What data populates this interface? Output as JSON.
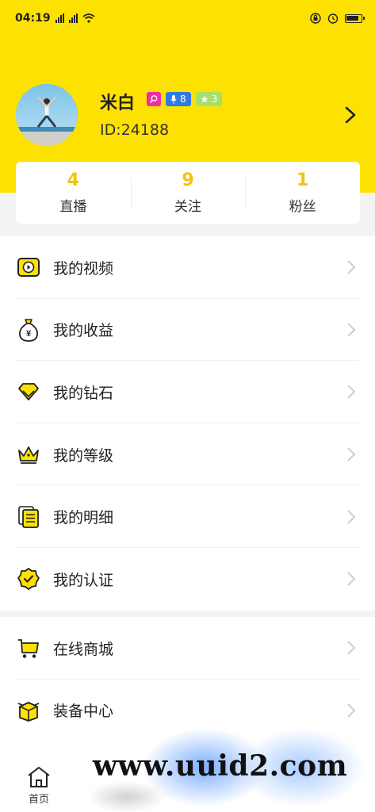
{
  "status_bar": {
    "time": "04:19"
  },
  "profile": {
    "name": "米白",
    "id_text": "ID:24188",
    "badges": {
      "voice_level": "8",
      "star_level": "3"
    }
  },
  "stats": [
    {
      "value": "4",
      "label": "直播"
    },
    {
      "value": "9",
      "label": "关注"
    },
    {
      "value": "1",
      "label": "粉丝"
    }
  ],
  "menu": [
    {
      "label": "我的视频",
      "icon": "video-icon"
    },
    {
      "label": "我的收益",
      "icon": "money-bag-icon"
    },
    {
      "label": "我的钻石",
      "icon": "diamond-icon"
    },
    {
      "label": "我的等级",
      "icon": "crown-icon"
    },
    {
      "label": "我的明细",
      "icon": "details-icon"
    },
    {
      "label": "我的认证",
      "icon": "certified-icon"
    }
  ],
  "menu2": [
    {
      "label": "在线商城",
      "icon": "cart-icon"
    },
    {
      "label": "装备中心",
      "icon": "box-icon"
    }
  ],
  "bottom_nav": {
    "home_label": "首页"
  },
  "watermark": "www.uuid2.com",
  "colors": {
    "accent": "#fde100",
    "stat_value": "#f1c40f"
  }
}
